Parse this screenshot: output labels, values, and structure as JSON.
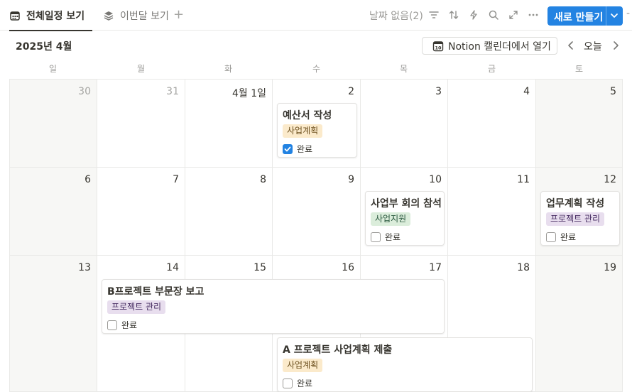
{
  "tabs": [
    {
      "label": "전체일정 보기",
      "icon": "calendar-icon",
      "active": true
    },
    {
      "label": "이번달 보기",
      "icon": "layers-icon",
      "active": false
    }
  ],
  "toolbar": {
    "no_date_label": "날짜 없음(2)",
    "new_button_label": "새로 만들기"
  },
  "header": {
    "month_label": "2025년 4월",
    "open_in_calendar_label": "Notion 캘린더에서 열기",
    "today_label": "오늘"
  },
  "weekdays": [
    "일",
    "월",
    "화",
    "수",
    "목",
    "금",
    "토"
  ],
  "weeks": [
    [
      "30",
      "31",
      "4월 1일",
      "2",
      "3",
      "4",
      "5"
    ],
    [
      "6",
      "7",
      "8",
      "9",
      "10",
      "11",
      "12"
    ],
    [
      "13",
      "14",
      "15",
      "16",
      "17",
      "18",
      "19"
    ]
  ],
  "events": [
    {
      "title": "예산서 작성",
      "tag": "사업계획",
      "tag_style": "yellow",
      "done_label": "완료",
      "done": true
    },
    {
      "title": "사업부 회의 참석",
      "tag": "사업지원",
      "tag_style": "green",
      "done_label": "완료",
      "done": false
    },
    {
      "title": "업무계획 작성",
      "tag": "프로젝트 관리",
      "tag_style": "purple",
      "done_label": "완료",
      "done": false
    },
    {
      "title": "B프로젝트 부문장 보고",
      "tag": "프로젝트 관리",
      "tag_style": "purple",
      "done_label": "완료",
      "done": false
    },
    {
      "title": "A 프로젝트 사업계획 제출",
      "tag": "사업계획",
      "tag_style": "yellow",
      "done_label": "완료",
      "done": false
    }
  ],
  "colors": {
    "accent": "#2383e2",
    "tag_yellow_bg": "#fbeacb",
    "tag_yellow_fg": "#6b4f1d",
    "tag_green_bg": "#dbeddb",
    "tag_green_fg": "#2b593f",
    "tag_purple_bg": "#e8deee",
    "tag_purple_fg": "#492f64"
  }
}
